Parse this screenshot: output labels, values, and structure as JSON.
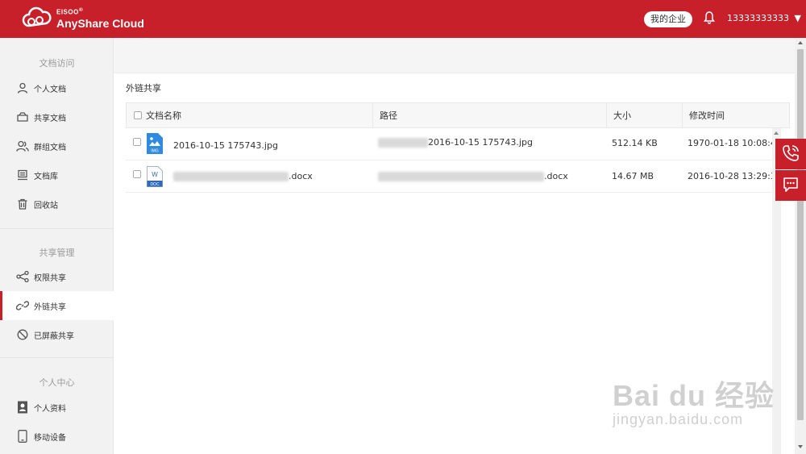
{
  "header": {
    "brand_small": "EISOO",
    "brand_registered": "®",
    "brand_name": "AnyShare Cloud",
    "company_button": "我的企业",
    "user_name": "13333333333",
    "user_caret": "▼",
    "brand_color": "#c8202a"
  },
  "sidebar": {
    "sections": [
      {
        "title": "文档访问",
        "items": [
          {
            "label": "个人文档",
            "icon": "person-icon"
          },
          {
            "label": "共享文档",
            "icon": "shared-folder-icon"
          },
          {
            "label": "群组文档",
            "icon": "group-icon"
          },
          {
            "label": "文档库",
            "icon": "library-icon"
          },
          {
            "label": "回收站",
            "icon": "trash-icon"
          }
        ]
      },
      {
        "title": "共享管理",
        "items": [
          {
            "label": "权限共享",
            "icon": "share-icon"
          },
          {
            "label": "外链共享",
            "icon": "link-icon",
            "active": true
          },
          {
            "label": "已屏蔽共享",
            "icon": "blocked-icon"
          }
        ]
      },
      {
        "title": "个人中心",
        "items": [
          {
            "label": "个人资料",
            "icon": "profile-icon"
          },
          {
            "label": "移动设备",
            "icon": "mobile-icon"
          }
        ]
      }
    ]
  },
  "main": {
    "page_title": "外链共享",
    "columns": [
      "文档名称",
      "路径",
      "大小",
      "修改时间"
    ],
    "rows": [
      {
        "name": "2016-10-15 175743.jpg",
        "file_type": "IMG",
        "path_suffix": "2016-10-15 175743.jpg",
        "size": "512.14 KB",
        "modified": "1970-01-18 10:08:45"
      },
      {
        "name_suffix": ".docx",
        "file_type": "DOC",
        "path_suffix": ".docx",
        "size": "14.67 MB",
        "modified": "2016-10-28 13:29:31"
      }
    ]
  },
  "watermark": {
    "logo": "Bai du 经验",
    "url": "jingyan.baidu.com"
  }
}
